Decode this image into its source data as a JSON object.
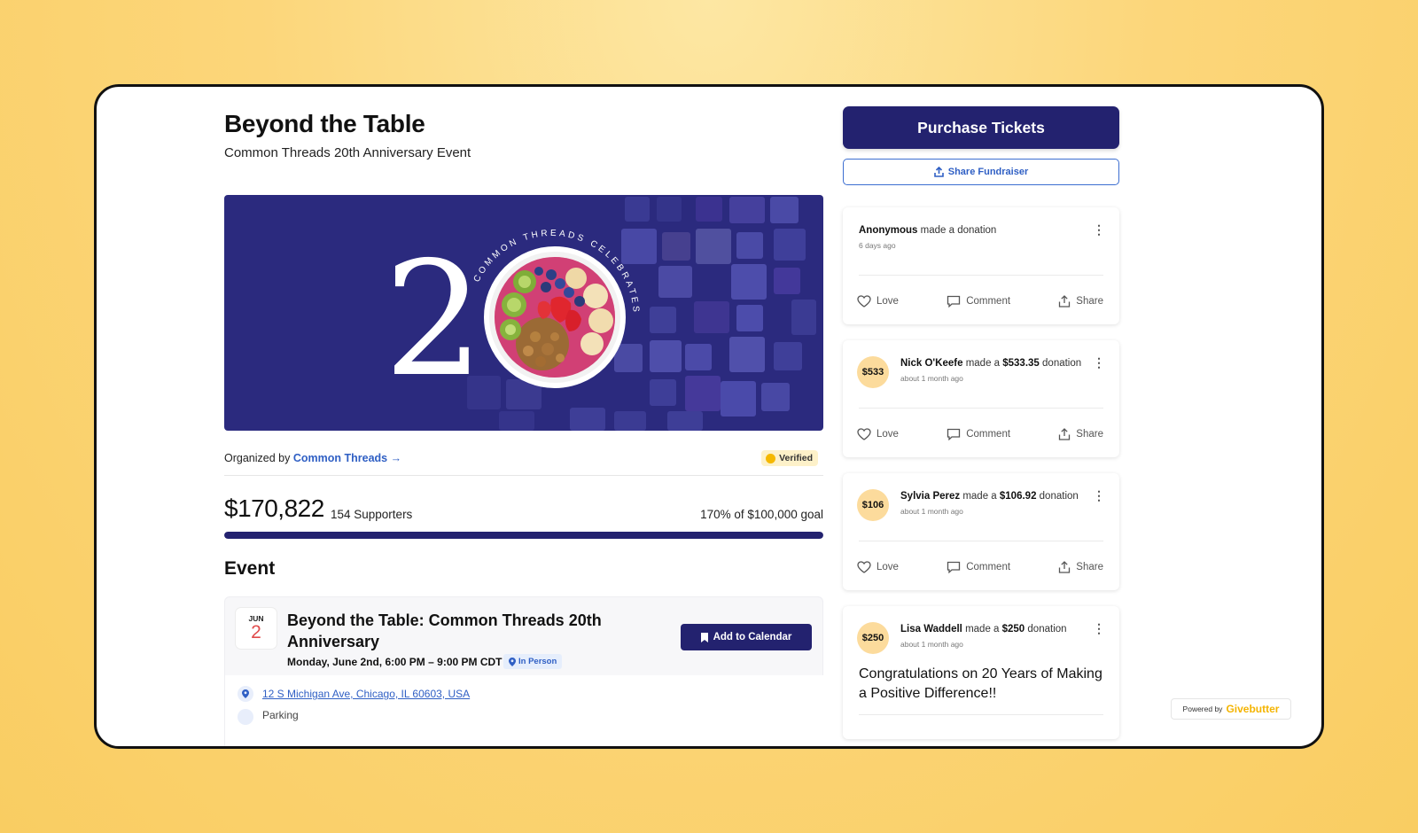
{
  "header": {
    "title": "Beyond the Table",
    "subtitle": "Common Threads 20th Anniversary Event"
  },
  "banner": {
    "big_number": "20",
    "ring_text": "COMMON THREADS CELEBRATES",
    "colors": {
      "background": "#2b2a7e"
    }
  },
  "organizer": {
    "prefix": "Organized by",
    "name": "Common Threads",
    "arrow": "→",
    "verified_label": "Verified"
  },
  "fundraising": {
    "amount": "$170,822",
    "supporters": "154 Supporters",
    "goal_text": "170% of $100,000 goal",
    "progress": 1.0
  },
  "event": {
    "heading": "Event",
    "month": "JUN",
    "day": "2",
    "title": "Beyond the Table: Common Threads 20th Anniversary",
    "time": "Monday, June 2nd, 6:00 PM – 9:00 PM CDT",
    "badge": "In Person",
    "add_to_calendar": "Add to Calendar",
    "address": "12 S Michigan Ave, Chicago, IL 60603, USA",
    "more": "Parking"
  },
  "sidebar": {
    "purchase_label": "Purchase Tickets",
    "share_label": "Share Fundraiser",
    "activity": [
      {
        "name": "Anonymous",
        "text": " made a donation",
        "amount": "",
        "suffix": "",
        "when": "6 days ago",
        "avatar": "",
        "message": ""
      },
      {
        "name": "Nick O'Keefe",
        "text": " made a ",
        "amount": "$533.35",
        "suffix": " donation",
        "when": "about 1 month ago",
        "avatar": "$533",
        "message": ""
      },
      {
        "name": "Sylvia Perez",
        "text": " made a ",
        "amount": "$106.92",
        "suffix": " donation",
        "when": "about 1 month ago",
        "avatar": "$106",
        "message": ""
      },
      {
        "name": "Lisa Waddell",
        "text": " made a ",
        "amount": "$250",
        "suffix": " donation",
        "when": "about 1 month ago",
        "avatar": "$250",
        "message": "Congratulations on 20 Years of Making a Positive Difference!!"
      }
    ],
    "actions": {
      "love": "Love",
      "comment": "Comment",
      "share": "Share"
    }
  },
  "footer": {
    "powered_by": "Powered by",
    "brand": "Givebutter"
  },
  "colors": {
    "accent": "#23226f",
    "link": "#2f5fc4",
    "page_bg": "#fcd67a",
    "avatar_bg": "#fcdb9c"
  }
}
